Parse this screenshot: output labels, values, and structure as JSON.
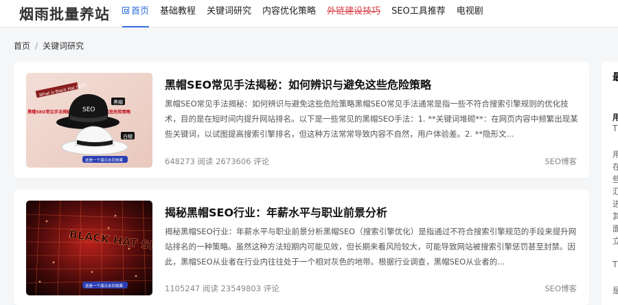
{
  "site": {
    "logo": "烟雨批量养站"
  },
  "nav": {
    "items": [
      {
        "label": "首页",
        "active": true
      },
      {
        "label": "基础教程"
      },
      {
        "label": "关键词研究"
      },
      {
        "label": "内容优化策略"
      },
      {
        "label": "外链建设技巧",
        "strikethrough": true
      },
      {
        "label": "SEO工具推荐"
      },
      {
        "label": "电视剧"
      }
    ]
  },
  "breadcrumb": {
    "home": "首页",
    "separator": "/",
    "current": "关键词研究"
  },
  "articles": [
    {
      "title": "黑帽SEO常见手法揭秘：如何辨识与避免这些危险策略",
      "excerpt": "黑帽SEO常见手法揭秘：如何辨识与避免这些危险策略黑帽SEO常见手法通常是指一些不符合搜索引擎规则的优化技术，目的是在短时间内提升网站排名。以下是一些常见的黑帽SEO手法：1. **关键词堆砌**：在网页内容中频繁出现某些关键词，以试图提高搜索引擎排名，但这种方法常常导致内容不自然，用户体验差。2. **隐形文...",
      "stats": "648273 阅读 2673606 评论",
      "source": "SEO博客",
      "thumb": {
        "banner": "What is Black Hat SEO?",
        "headline": "黑帽SEO常见手法揭秘：如何辨识与避免这些危险策略",
        "hat_label_black": "黑帽",
        "hat_label_seo": "SEO",
        "hat_label_white": "白帽",
        "badge": "这是一个演示水印效果"
      }
    },
    {
      "title": "揭秘黑帽SEO行业：年薪水平与职业前景分析",
      "excerpt": "揭秘黑帽SEO行业：年薪水平与职业前景分析黑帽SEO（搜索引擎优化）是指通过不符合搜索引擎规范的手段来提升网站排名的一种策略。虽然这种方法短期内可能见效，但长期来看风险较大，可能导致网站被搜索引擎惩罚甚至封禁。因此，黑帽SEO从业者在行业内往往处于一个相对灰色的地带。根据行业调查，黑帽SEO从业者的...",
      "stats": "1105247 阅读 23549803 评论",
      "source": "SEO博客",
      "thumb": {
        "text": "BLACK HAT SEO",
        "badge": "这是一个演示水印效果"
      }
    }
  ],
  "sidebar": {
    "heading": "最",
    "lines": [
      "用",
      "T",
      "用",
      "在",
      "些",
      "汇",
      "进",
      "其",
      "面",
      "立",
      "T",
      "是"
    ]
  },
  "colors": {
    "accent": "#2f6fdc",
    "strike": "#d9434a",
    "background": "#f5f6f8"
  }
}
